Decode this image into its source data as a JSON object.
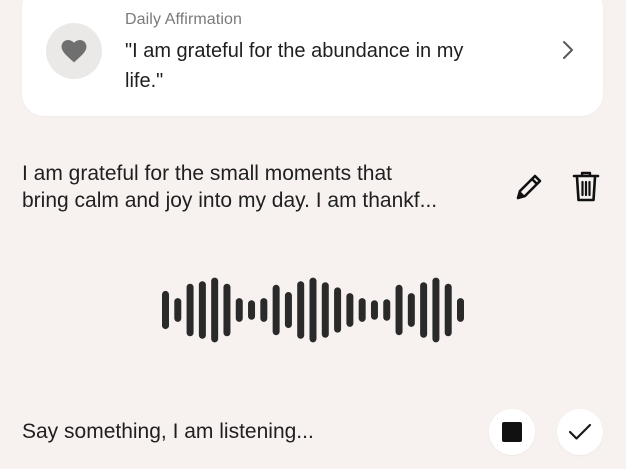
{
  "affirmation": {
    "label": "Daily Affirmation",
    "lines": [
      "\"I am grateful for the abundance in my",
      "life.\""
    ],
    "icon": "heart-icon"
  },
  "entry": {
    "lines": [
      "I am grateful for the small moments that",
      "bring calm and joy into my day. I am thankf..."
    ],
    "edit_icon": "pencil-icon",
    "delete_icon": "trash-icon"
  },
  "recorder": {
    "status": "Say something, I am listening...",
    "stop_icon": "stop-icon",
    "confirm_icon": "check-icon",
    "waveform_levels": [
      0.53,
      0.33,
      0.73,
      0.8,
      0.9,
      0.73,
      0.33,
      0.27,
      0.33,
      0.7,
      0.5,
      0.8,
      0.9,
      0.77,
      0.63,
      0.47,
      0.33,
      0.27,
      0.3,
      0.7,
      0.47,
      0.77,
      0.9,
      0.73,
      0.33
    ]
  },
  "colors": {
    "background": "#f7f2ef",
    "card": "#ffffff",
    "icon_circle": "#ebe9e8",
    "heart": "#6f6f6f",
    "waveform": "#2a2a2a",
    "text": "#1f1f1f",
    "muted_text": "#7a7a7a"
  }
}
